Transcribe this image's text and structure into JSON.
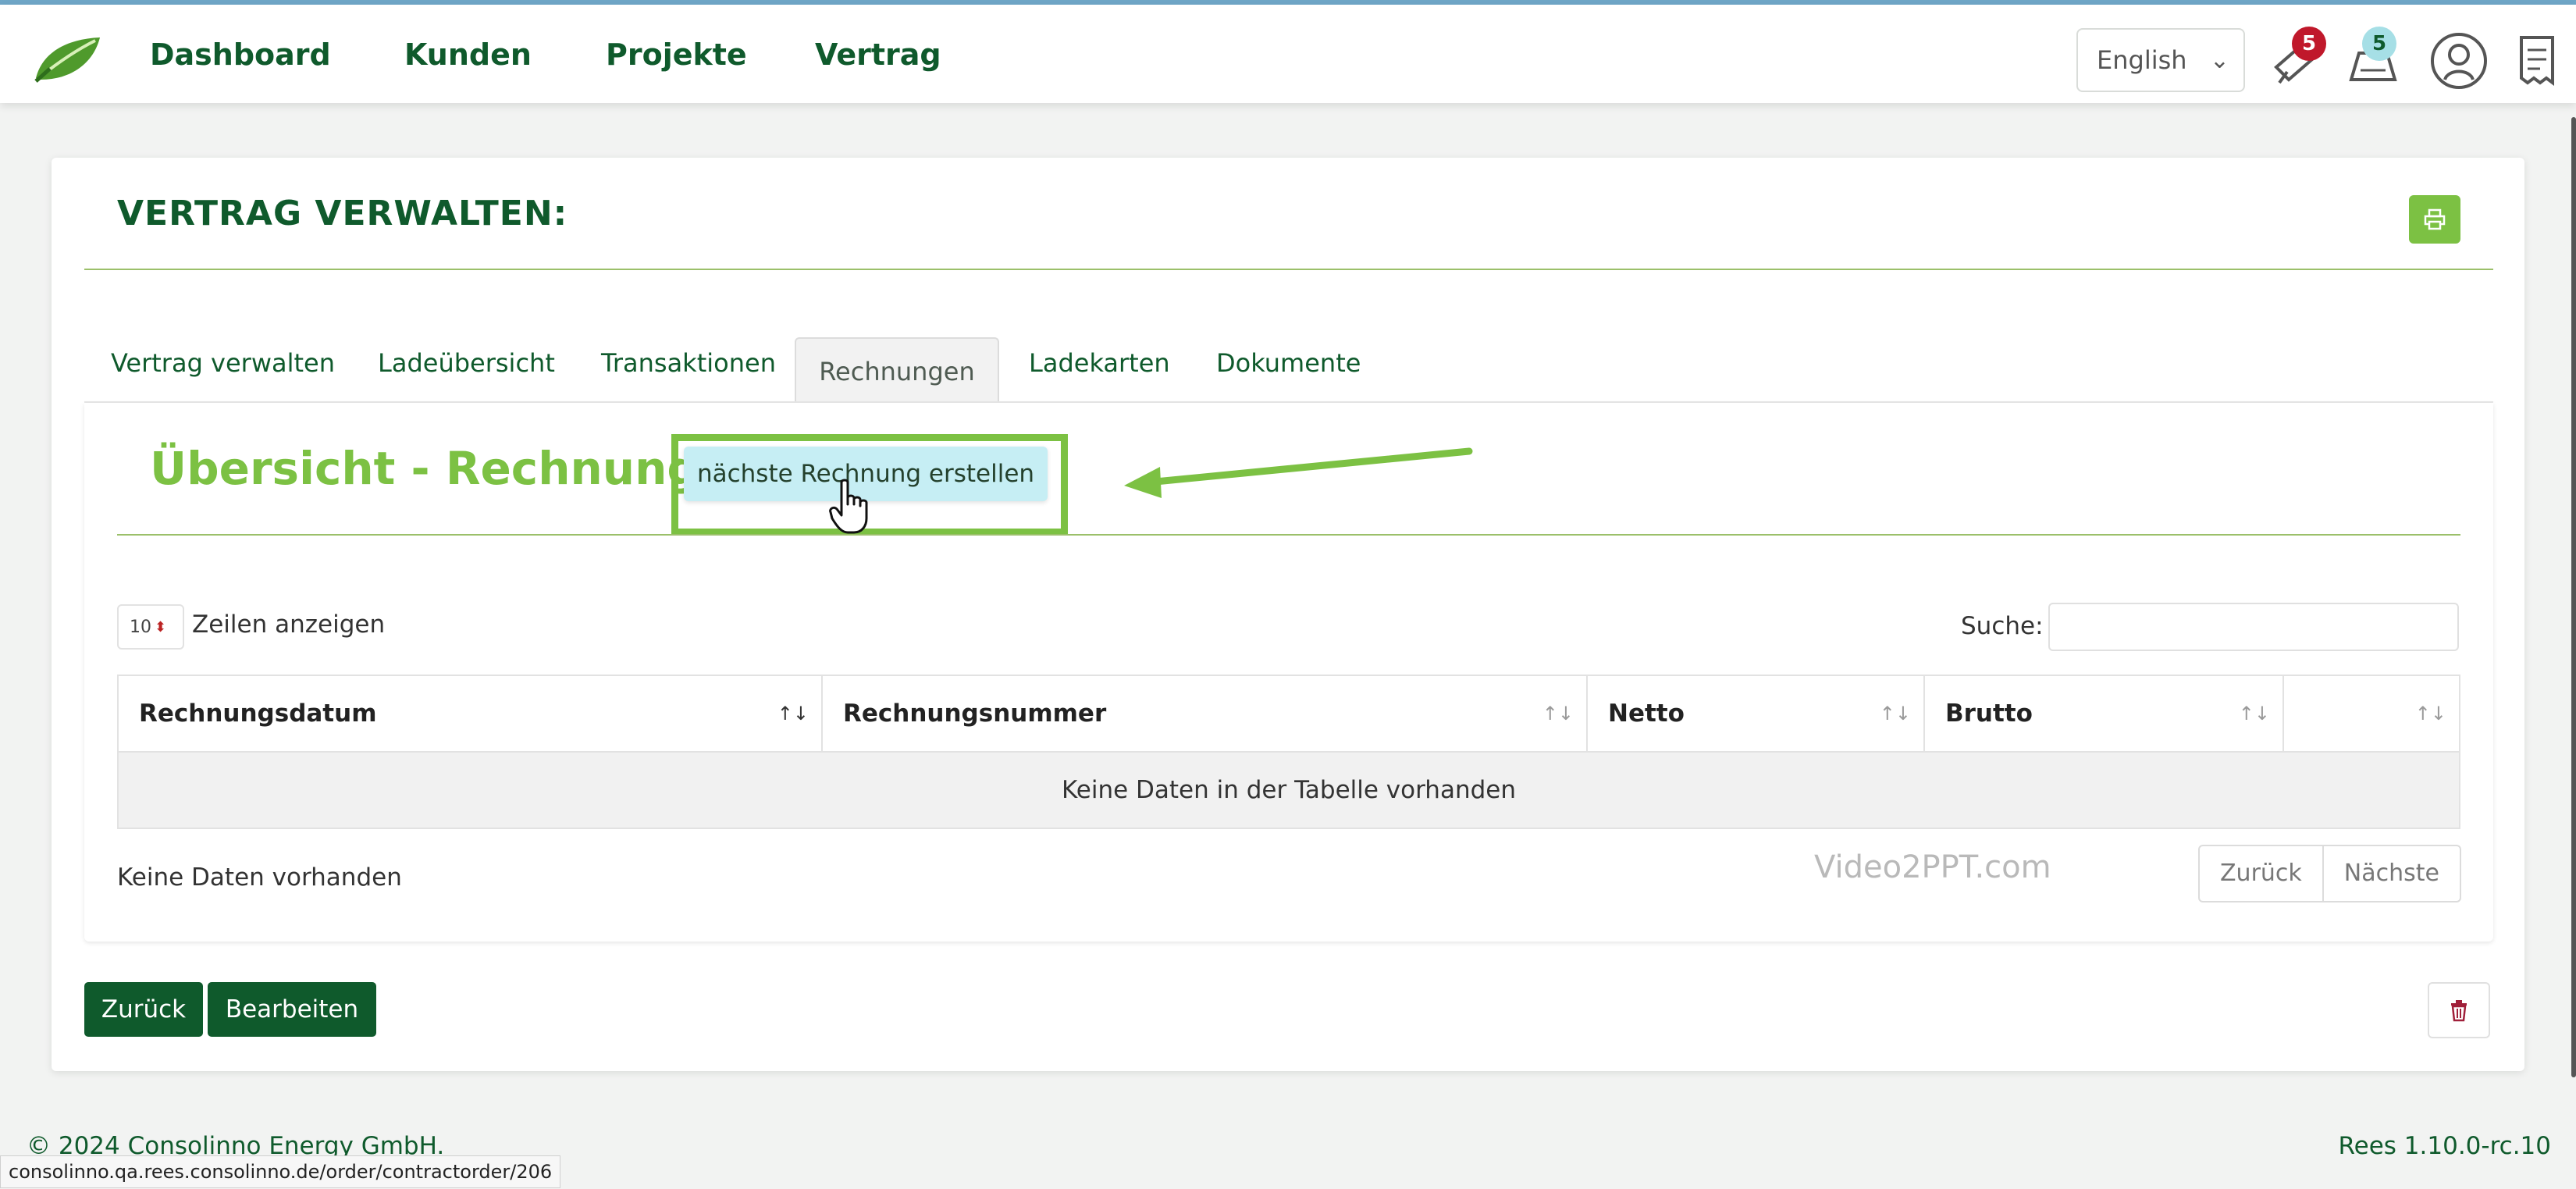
{
  "nav": {
    "items": [
      "Dashboard",
      "Kunden",
      "Projekte",
      "Vertrag"
    ],
    "language": "English",
    "notifications_count": "5",
    "messages_count": "5"
  },
  "page": {
    "title": "VERTRAG VERWALTEN:",
    "tabs": [
      "Vertrag verwalten",
      "Ladeübersicht",
      "Transaktionen",
      "Rechnungen",
      "Ladekarten",
      "Dokumente"
    ],
    "active_tab": "Rechnungen"
  },
  "section": {
    "title": "Übersicht - Rechnungen",
    "next_invoice_button": "nächste Rechnung erstellen"
  },
  "table": {
    "page_length": "10",
    "page_length_label": "Zeilen anzeigen",
    "search_label": "Suche:",
    "search_value": "",
    "columns": [
      "Rechnungsdatum",
      "Rechnungsnummer",
      "Netto",
      "Brutto",
      ""
    ],
    "empty_message": "Keine Daten in der Tabelle vorhanden",
    "info": "Keine Daten vorhanden",
    "prev_label": "Zurück",
    "next_label": "Nächste"
  },
  "watermark": "Video2PPT.com",
  "actions": {
    "back": "Zurück",
    "edit": "Bearbeiten"
  },
  "footer": {
    "copyright": "© 2024 Consolinno Energy GmbH.",
    "version": "Rees 1.10.0-rc.10"
  },
  "statusbar": {
    "url": "consolinno.qa.rees.consolinno.de/order/contractorder/206"
  },
  "icons": {
    "logo": "leaf-logo-icon",
    "notifications": "bell-icon",
    "messages": "inbox-icon",
    "user": "user-avatar-icon",
    "receipt": "receipt-icon",
    "print": "printer-icon",
    "delete": "trash-icon"
  },
  "colors": {
    "brand_dark_green": "#0f5a2c",
    "brand_light_green": "#7cc143",
    "button_highlight": "#c6eef4",
    "badge_red": "#c0182b",
    "badge_teal": "#a6dfe6"
  }
}
